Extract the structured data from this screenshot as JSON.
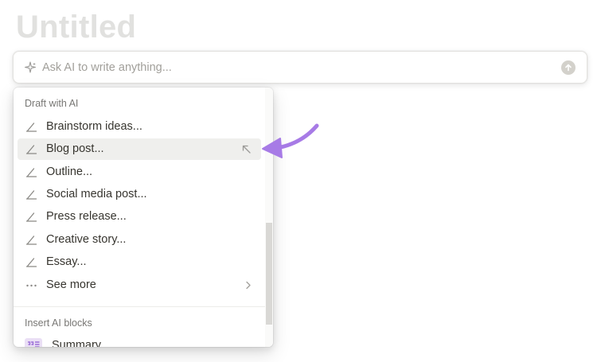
{
  "page": {
    "title": "Untitled"
  },
  "ai_bar": {
    "placeholder": "Ask AI to write anything..."
  },
  "menu": {
    "draft_section_label": "Draft with AI",
    "draft_items": [
      {
        "label": "Brainstorm ideas...",
        "icon": "pencil-icon"
      },
      {
        "label": "Blog post...",
        "icon": "pencil-icon",
        "active": true
      },
      {
        "label": "Outline...",
        "icon": "pencil-icon"
      },
      {
        "label": "Social media post...",
        "icon": "pencil-icon"
      },
      {
        "label": "Press release...",
        "icon": "pencil-icon"
      },
      {
        "label": "Creative story...",
        "icon": "pencil-icon"
      },
      {
        "label": "Essay...",
        "icon": "pencil-icon"
      }
    ],
    "see_more": {
      "label": "See more",
      "icon": "more-dots-icon"
    },
    "blocks_section_label": "Insert AI blocks",
    "block_items": [
      {
        "label": "Summary",
        "icon": "summary-block-icon"
      }
    ]
  },
  "colors": {
    "accent_purple": "#a77be6",
    "active_row": "#efefed",
    "placeholder_gray": "#a19f9a"
  }
}
